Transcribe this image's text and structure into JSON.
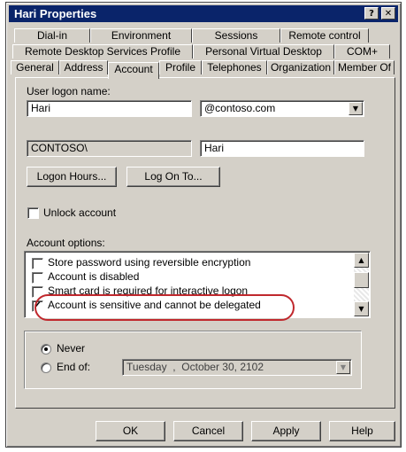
{
  "window": {
    "title": "Hari Properties",
    "help_glyph": "?",
    "close_glyph": "✕"
  },
  "tabs": {
    "row1": [
      "Dial-in",
      "Environment",
      "Sessions",
      "Remote control"
    ],
    "row2": [
      "Remote Desktop Services Profile",
      "Personal Virtual Desktop",
      "COM+"
    ],
    "row3": [
      "General",
      "Address",
      "Account",
      "Profile",
      "Telephones",
      "Organization",
      "Member Of"
    ],
    "active": "Account"
  },
  "account": {
    "logon_label": "User logon name:",
    "logon_value": "Hari",
    "upn_suffix": "@contoso.com",
    "domain_prefix": "CONTOSO\\",
    "pre2000_value": "Hari",
    "logon_hours_button": "Logon Hours...",
    "logon_to_button": "Log On To...",
    "unlock_label": "Unlock account",
    "options_label": "Account options:",
    "options": [
      {
        "label": "Store password using reversible encryption",
        "checked": false
      },
      {
        "label": "Account is disabled",
        "checked": false
      },
      {
        "label": "Smart card is required for interactive logon",
        "checked": false
      },
      {
        "label": "Account is sensitive and cannot be delegated",
        "checked": true
      }
    ],
    "expires": {
      "never_label": "Never",
      "endof_label": "End of:",
      "selected": "never",
      "date_day": "Tuesday",
      "date_sep": ",",
      "date_month_day": "October   30, 2102"
    }
  },
  "footer": {
    "ok": "OK",
    "cancel": "Cancel",
    "apply": "Apply",
    "help": "Help"
  },
  "colors": {
    "titlebar": "#0a246a",
    "highlight_ring": "#c0282d",
    "face": "#d4d0c8"
  }
}
